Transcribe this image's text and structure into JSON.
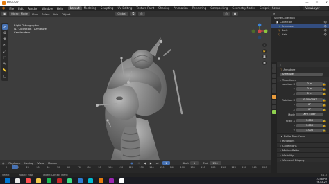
{
  "titlebar": {
    "title": "Blender",
    "minimize": "—",
    "maximize": "☐",
    "close": "✕"
  },
  "menu": {
    "items": [
      "File",
      "Edit",
      "Render",
      "Window",
      "Help"
    ],
    "tabs": [
      {
        "label": "Layout",
        "active": true
      },
      {
        "label": "Modeling"
      },
      {
        "label": "Sculpting"
      },
      {
        "label": "UV Editing"
      },
      {
        "label": "Texture Paint"
      },
      {
        "label": "Shading"
      },
      {
        "label": "Animation"
      },
      {
        "label": "Rendering"
      },
      {
        "label": "Compositing"
      },
      {
        "label": "Geometry Nodes"
      },
      {
        "label": "Scripting"
      }
    ],
    "scene": "Scene",
    "view_layer": "ViewLayer"
  },
  "viewport_header": {
    "mode": "Object Mode",
    "items": [
      "View",
      "Select",
      "Add",
      "Object"
    ],
    "transform_orientation": "Global"
  },
  "viewport_info": {
    "view": "Right Orthographic",
    "collection": "(1) Collection | Armature",
    "units": "Centimeters"
  },
  "toolbar_icons": [
    "cursor-icon",
    "move-icon",
    "rotate-icon",
    "scale-icon",
    "transform-icon",
    "annotate-icon",
    "measure-icon",
    "add-icon"
  ],
  "outliner": {
    "header": "Scene Collection",
    "rows": [
      {
        "label": "Scene Collection",
        "selected": false
      },
      {
        "label": "Collection",
        "selected": false
      },
      {
        "label": "Armature",
        "selected": true
      },
      {
        "label": "Body",
        "selected": false
      },
      {
        "label": "Hair",
        "selected": false
      }
    ]
  },
  "properties": {
    "object_name": "Armature",
    "object_field": "Armature",
    "transform_label": "Transform",
    "location": {
      "label": "Location X",
      "y_label": "Y",
      "z_label": "Z",
      "x": "0 m",
      "y": "0 m",
      "z": "0 m"
    },
    "rotation": {
      "label": "Rotation X",
      "y_label": "Y",
      "z_label": "Z",
      "x": "-0.000009°",
      "y": "0°",
      "z": "0°"
    },
    "mode": {
      "label": "Mode",
      "value": "XYZ Euler"
    },
    "scale": {
      "label": "Scale X",
      "y_label": "Y",
      "z_label": "Z",
      "x": "1.000",
      "y": "1.000",
      "z": "1.000"
    },
    "sections": [
      "Delta Transform",
      "Relations",
      "Collections",
      "Motion Paths",
      "Visibility",
      "Viewport Display"
    ]
  },
  "timeline": {
    "menu": [
      "Playback",
      "Keying",
      "View",
      "Marker"
    ],
    "current_frame": "1",
    "start_label": "Start",
    "start": "1",
    "end_label": "End",
    "end": "250",
    "ticks": [
      "0",
      "10",
      "20",
      "30",
      "40",
      "50",
      "60",
      "70",
      "80",
      "90",
      "100",
      "110",
      "120",
      "130",
      "140",
      "150",
      "160",
      "170",
      "180",
      "190",
      "200",
      "210",
      "220",
      "230",
      "240",
      "250"
    ]
  },
  "statusbar": {
    "select": "Select",
    "rotate": "Rotate View",
    "context": "Object Context Menu",
    "version": "3.1.0"
  },
  "taskbar": {
    "time": "10:48 PM",
    "date": "06-Jul-22",
    "icon_colors": [
      "#0078d4",
      "#e8e8e8",
      "#ff4f4f",
      "#f2c94c",
      "#1db954",
      "#c62828",
      "#3ddc84",
      "#2d7dd2",
      "#00bcd4",
      "#e87d0d",
      "#9c27b0",
      "#ffffff"
    ]
  },
  "colors": {
    "accent": "#4772b3",
    "orange": "#e87d0d",
    "viewport_bg": "#3d3d3d"
  }
}
